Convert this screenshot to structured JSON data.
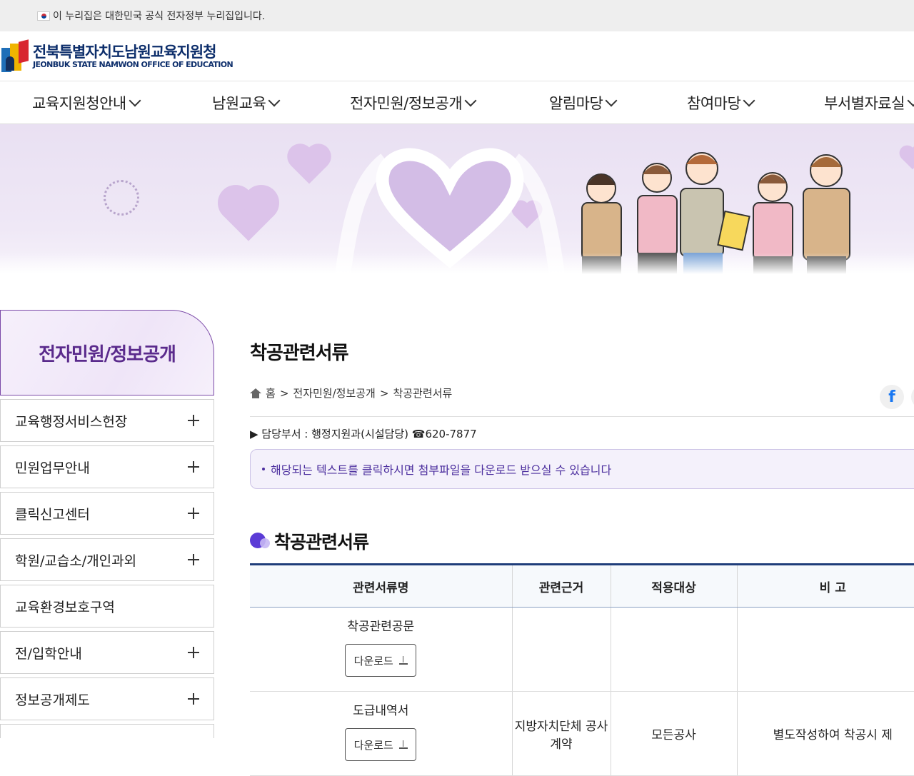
{
  "gov_banner": {
    "text": "이 누리집은 대한민국 공식 전자정부 누리집입니다."
  },
  "logo": {
    "ko": "전북특별자치도남원교육지원청",
    "en": "JEONBUK STATE NAMWON OFFICE OF EDUCATION"
  },
  "gnb": {
    "items": [
      {
        "label": "교육지원청안내"
      },
      {
        "label": "남원교육"
      },
      {
        "label": "전자민원/정보공개"
      },
      {
        "label": "알림마당"
      },
      {
        "label": "참여마당"
      },
      {
        "label": "부서별자료실"
      }
    ]
  },
  "sidebar": {
    "title": "전자민원/정보공개",
    "items": [
      {
        "label": "교육행정서비스헌장",
        "expandable": true
      },
      {
        "label": "민원업무안내",
        "expandable": true
      },
      {
        "label": "클릭신고센터",
        "expandable": true
      },
      {
        "label": "학원/교습소/개인과외",
        "expandable": true
      },
      {
        "label": "교육환경보호구역",
        "expandable": false
      },
      {
        "label": "전/입학안내",
        "expandable": true
      },
      {
        "label": "정보공개제도",
        "expandable": true
      }
    ]
  },
  "content": {
    "page_title": "착공관련서류",
    "breadcrumb": {
      "home": "홈",
      "sep": ">",
      "level1": "전자민원/정보공개",
      "level2": "착공관련서류"
    },
    "dept": "▶ 담당부서 : 행정지원과(시설담당) ☎620-7877",
    "notice": "해당되는 텍스트를 클릭하시면 첨부파일을 다운로드 받으실 수 있습니다",
    "section_title": "착공관련서류",
    "table": {
      "headers": [
        "관련서류명",
        "관련근거",
        "적용대상",
        "비 고"
      ],
      "download_label": "다운로드",
      "rows": [
        {
          "doc": "착공관련공문",
          "basis": "",
          "target": "",
          "note": ""
        },
        {
          "doc": "도급내역서",
          "basis": "지방자치단체 공사계약",
          "target": "모든공사",
          "note": "별도작성하여 착공시 제"
        }
      ]
    }
  },
  "colors": {
    "brand": "#0d2e6b",
    "accent": "#5a2a8c",
    "table_top": "#1f3d7a",
    "notice_text": "#4b2e9e"
  }
}
